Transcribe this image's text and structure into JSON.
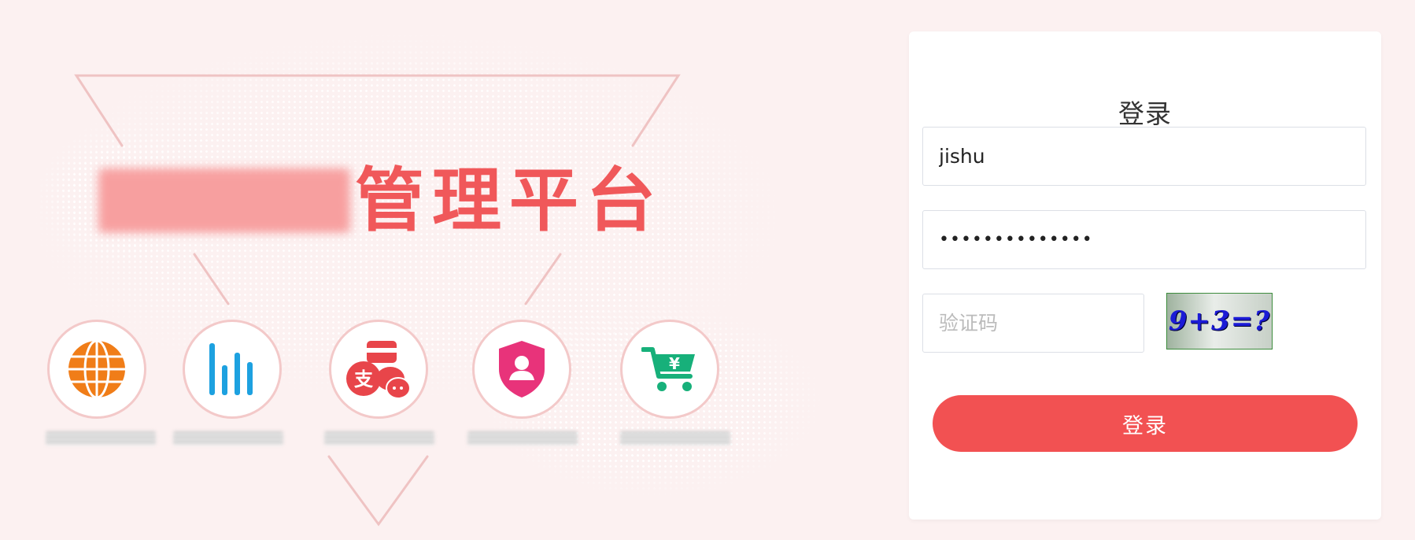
{
  "hero": {
    "title_suffix": "管理平台",
    "features": [
      {
        "icon": "globe-icon",
        "color": "#f07d18"
      },
      {
        "icon": "bar-chart-icon",
        "color": "#1da1e0"
      },
      {
        "icon": "payment-icon",
        "color": "#e8454a"
      },
      {
        "icon": "shield-user-icon",
        "color": "#e8337a"
      },
      {
        "icon": "cart-icon",
        "color": "#17b07a"
      }
    ]
  },
  "login": {
    "title": "登录",
    "username_value": "jishu",
    "password_value": "••••••••••••••",
    "captcha_placeholder": "验证码",
    "captcha_text": "9+3=?",
    "submit_label": "登录"
  },
  "colors": {
    "accent": "#f25152",
    "background": "#fcf1f1"
  }
}
